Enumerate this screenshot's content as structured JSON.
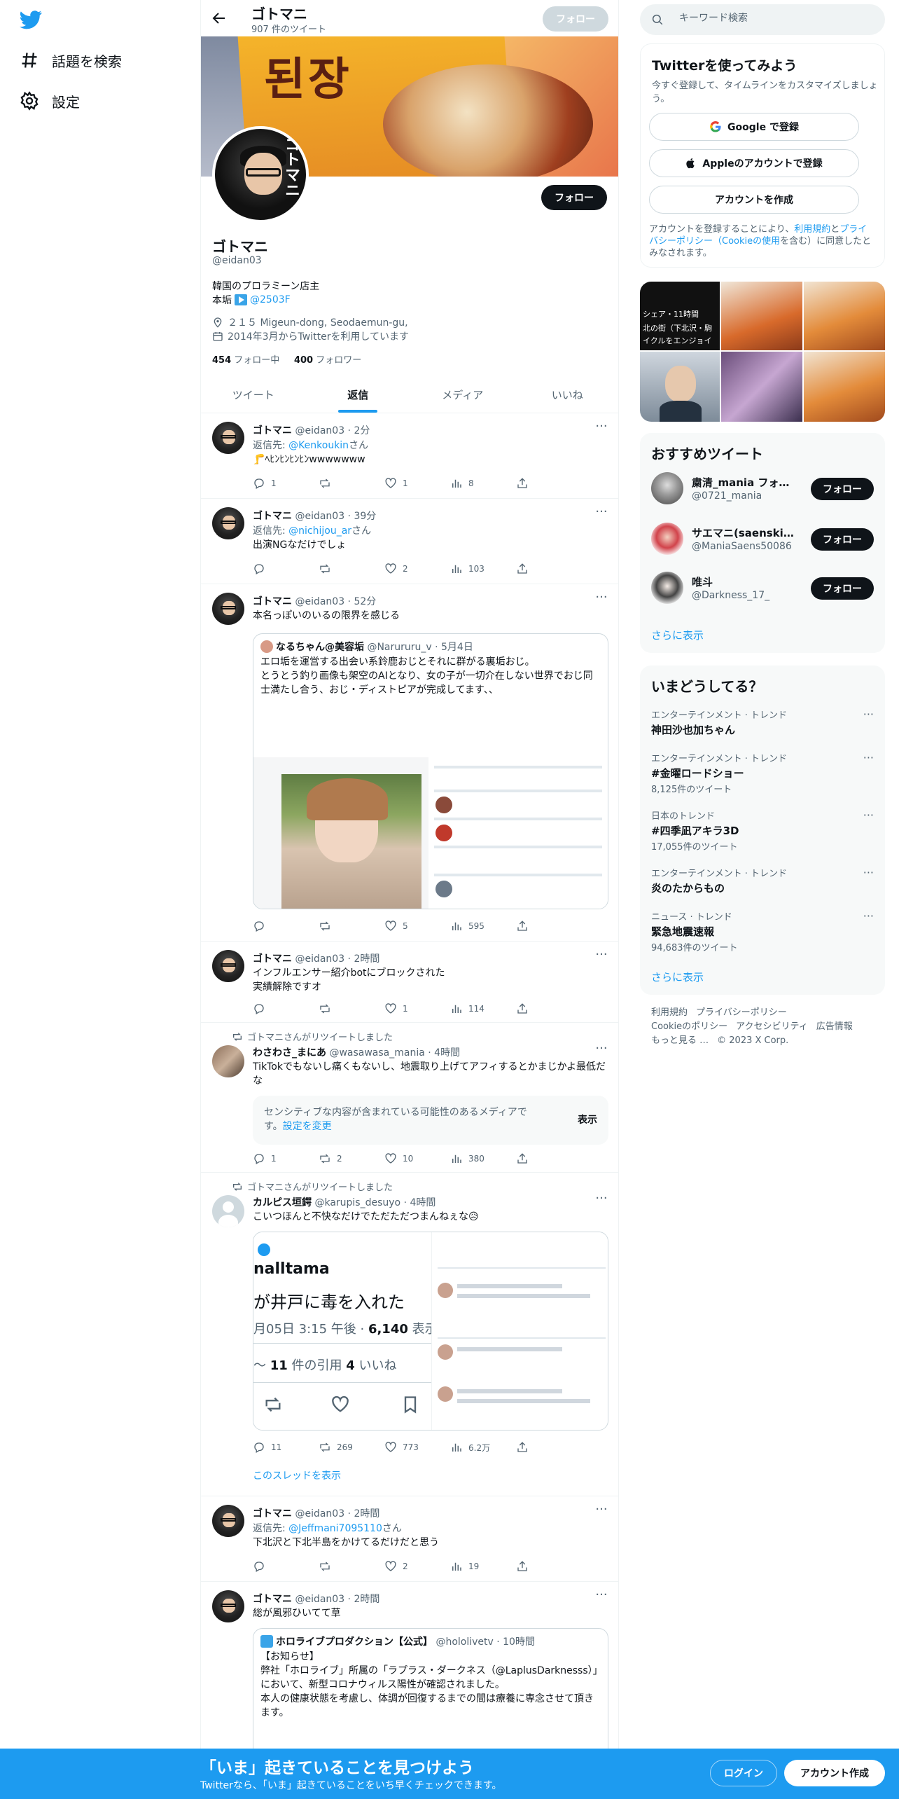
{
  "nav": {
    "explore_label": "話題を検索",
    "settings_label": "設定"
  },
  "header": {
    "name": "ゴトマニ",
    "tweet_count": "907 件のツイート",
    "follow_label": "フォロー"
  },
  "profile": {
    "avatar_text": "ゴトマニ",
    "name": "ゴトマニ",
    "handle": "@eidan03",
    "follow_label": "フォロー",
    "bio_line1": "韓国のプロラミーン店主",
    "bio_line2_prefix": "本垢",
    "bio_line2_link": "@2503F",
    "location": "２１５ Migeun-dong, Seodaemun-gu,",
    "joined": "2014年3月からTwitterを利用しています",
    "following_count": "454",
    "following_label": "フォロー中",
    "followers_count": "400",
    "followers_label": "フォロワー"
  },
  "tabs": [
    "ツイート",
    "返信",
    "メディア",
    "いいね"
  ],
  "tweets": [
    {
      "name": "ゴトマニ",
      "meta": "@eidan03 · 2分",
      "reply_prefix": "返信先: ",
      "reply_to": "@Kenkoukin",
      "reply_suffix": "さん",
      "text": "🦵ﾍﾋﾝﾋﾝﾋﾝﾋﾝwwwwwww",
      "replies": "1",
      "retweets": "",
      "likes": "1",
      "views": "8"
    },
    {
      "name": "ゴトマニ",
      "meta": "@eidan03 · 39分",
      "reply_prefix": "返信先: ",
      "reply_to": "@nichijou_ar",
      "reply_suffix": "さん",
      "text": "出演NGなだけでしょ",
      "replies": "",
      "retweets": "",
      "likes": "2",
      "views": "103"
    },
    {
      "name": "ゴトマニ",
      "meta": "@eidan03 · 52分",
      "text": "本名っぽいのいるの限界を感じる",
      "quote_name": "なるちゃん@美容垢",
      "quote_meta": "@Narururu_v · 5月4日",
      "quote_text": "エロ垢を運営する出会い系鈴鹿おじとそれに群がる裏垢おじ。\nとうとう釣り画像も架空のAIとなり、女の子が一切介在しない世界でおじ同士満たし合う、おじ・ディストピアが完成してます、、",
      "replies": "",
      "retweets": "",
      "likes": "5",
      "views": "595"
    },
    {
      "name": "ゴトマニ",
      "meta": "@eidan03 · 2時間",
      "text": "インフルエンサー紹介botにブロックされた\n実績解除ですオ",
      "replies": "",
      "retweets": "",
      "likes": "1",
      "views": "114"
    },
    {
      "rt_by": "ゴトマニさんがリツイートしました",
      "name": "わさわさ_まにあ",
      "meta": "@wasawasa_mania · 4時間",
      "text": "TikTokでもないし痛くもないし、地震取り上げてアフィするとかまじかよ最低だな",
      "sensitive_text": "センシティブな内容が含まれている可能性のあるメディアです。",
      "sensitive_link": "設定を変更",
      "sensitive_btn": "表示",
      "replies": "1",
      "retweets": "2",
      "likes": "10",
      "views": "380"
    },
    {
      "rt_by": "ゴトマニさんがリツイートしました",
      "name": "カルピス垣鍔",
      "meta": "@karupis_desuyo · 4時間",
      "text": "こいつほんと不快なだけでただただつまんねぇな😥",
      "quote_img_title": "nalltama",
      "quote_img_headline": "が井戸に毒を入れた",
      "quote_img_date": "月05日 3:15 午後 · ",
      "quote_img_views": "6,140",
      "quote_img_views_suffix": " 表示",
      "quote_img_quotes": "11",
      "quote_img_quotes_label": " 件の引用  ",
      "quote_img_likes": "4",
      "quote_img_likes_label": " いいね",
      "replies": "11",
      "retweets": "269",
      "likes": "773",
      "views": "6.2万",
      "thread_label": "このスレッドを表示"
    },
    {
      "name": "ゴトマニ",
      "meta": "@eidan03 · 2時間",
      "reply_prefix": "返信先: ",
      "reply_to": "@Jeffmani7095110",
      "reply_suffix": "さん",
      "text": "下北沢と下北半島をかけてるだけだと思う",
      "replies": "",
      "retweets": "",
      "likes": "2",
      "views": "19"
    },
    {
      "name": "ゴトマニ",
      "meta": "@eidan03 · 2時間",
      "text": "総が風邪ひいてて草",
      "quote_name": "ホロライブプロダクション【公式】",
      "quote_meta": "@hololivetv · 10時間",
      "quote_text": "【お知らせ】\n弊社「ホロライブ」所属の「ラプラス・ダークネス（@LaplusDarknesss）」において、新型コロナウィルス陽性が確認されました。\n本人の健康状態を考慮し、体調が回復するまでの間は療養に専念させて頂きます。"
    }
  ],
  "search": {
    "placeholder": "キーワード検索"
  },
  "signup": {
    "title": "Twitterを使ってみよう",
    "subtitle": "今すぐ登録して、タイムラインをカスタマイズしましょう。",
    "google": "Google で登録",
    "apple": "Appleのアカウントで登録",
    "create": "アカウントを作成",
    "note_prefix": "アカウントを登録することにより、",
    "note_terms": "利用規約",
    "note_and": "と",
    "note_privacy": "プライバシーポリシー（Cookieの使用",
    "note_suffix": "を含む）に同意したとみなされます。"
  },
  "media": {
    "caption1": "シェア・11時間",
    "caption2": "北の街（下北沢・駒",
    "caption3": "イクルをエンジョイ"
  },
  "recommended": {
    "title": "おすすめツイート",
    "follow_label": "フォロー",
    "more": "さらに表示",
    "accounts": [
      {
        "name": "粛清_mania フォロ…",
        "handle": "@0721_mania"
      },
      {
        "name": "サエマニ(saenskin_…",
        "handle": "@ManiaSaens50086"
      },
      {
        "name": "唯斗",
        "handle": "@Darkness_17_"
      }
    ]
  },
  "trends": {
    "title": "いまどうしてる？",
    "more": "さらに表示",
    "items": [
      {
        "context": "エンターテインメント · トレンド",
        "name": "神田沙也加ちゃん",
        "count": ""
      },
      {
        "context": "エンターテインメント · トレンド",
        "name": "#金曜ロードショー",
        "count": "8,125件のツイート"
      },
      {
        "context": "日本のトレンド",
        "name": "#四季凪アキラ3D",
        "count": "17,055件のツイート"
      },
      {
        "context": "エンターテインメント · トレンド",
        "name": "炎のたからもの",
        "count": ""
      },
      {
        "context": "ニュース · トレンド",
        "name": "緊急地震速報",
        "count": "94,683件のツイート"
      }
    ]
  },
  "footer": {
    "terms": "利用規約",
    "privacy": "プライバシーポリシー",
    "cookie": "Cookieのポリシー",
    "accessibility": "アクセシビリティ",
    "ads": "広告情報",
    "more": "もっと見る …",
    "copyright": "© 2023 X Corp."
  },
  "bottom": {
    "title": "「いま」起きていることを見つけよう",
    "subtitle": "Twitterなら、「いま」起きていることをいち早くチェックできます。",
    "login": "ログイン",
    "signup": "アカウント作成"
  },
  "colors": {
    "accent": "#1d9bf0",
    "text": "#0f1419",
    "muted": "#536471"
  }
}
